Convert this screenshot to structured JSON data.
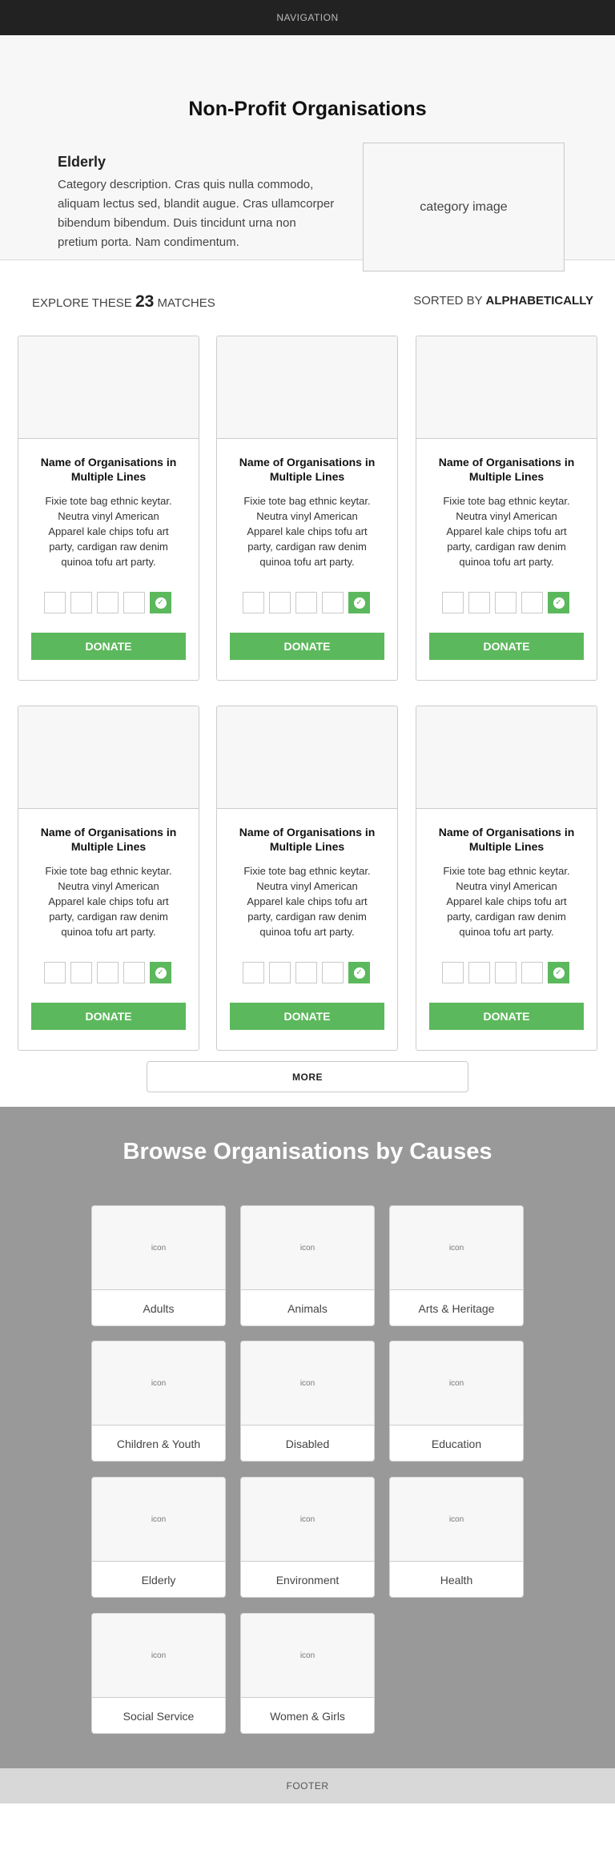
{
  "navigation": {
    "label": "NAVIGATION"
  },
  "hero": {
    "title": "Non-Profit Organisations",
    "category_name": "Elderly",
    "category_description": "Category description. Cras quis nulla commodo, aliquam lectus sed, blandit augue. Cras ullamcorper bibendum bibendum. Duis tincidunt urna non pretium porta. Nam condimentum.",
    "category_image_label": "category image"
  },
  "results": {
    "explore_prefix": "EXPLORE THESE",
    "count": "23",
    "explore_suffix": "MATCHES",
    "sorted_prefix": "SORTED BY",
    "sorted_value": "ALPHABETICALLY"
  },
  "cards": [
    {
      "name": "Name of Organisations in Multiple Lines",
      "description": "Fixie tote bag ethnic keytar. Neutra vinyl American Apparel kale chips tofu art party, cardigan raw denim quinoa tofu art party.",
      "donate_label": "DONATE"
    },
    {
      "name": "Name of Organisations in Multiple Lines",
      "description": "Fixie tote bag ethnic keytar. Neutra vinyl American Apparel kale chips tofu art party, cardigan raw denim quinoa tofu art party.",
      "donate_label": "DONATE"
    },
    {
      "name": "Name of Organisations in Multiple Lines",
      "description": "Fixie tote bag ethnic keytar. Neutra vinyl American Apparel kale chips tofu art party, cardigan raw denim quinoa tofu art party.",
      "donate_label": "DONATE"
    },
    {
      "name": "Name of Organisations in Multiple Lines",
      "description": "Fixie tote bag ethnic keytar. Neutra vinyl American Apparel kale chips tofu art party, cardigan raw denim quinoa tofu art party.",
      "donate_label": "DONATE"
    },
    {
      "name": "Name of Organisations in Multiple Lines",
      "description": "Fixie tote bag ethnic keytar. Neutra vinyl American Apparel kale chips tofu art party, cardigan raw denim quinoa tofu art party.",
      "donate_label": "DONATE"
    },
    {
      "name": "Name of Organisations in Multiple Lines",
      "description": "Fixie tote bag ethnic keytar. Neutra vinyl American Apparel kale chips tofu art party, cardigan raw denim quinoa tofu art party.",
      "donate_label": "DONATE"
    }
  ],
  "more_label": "MORE",
  "causes": {
    "title": "Browse Organisations by Causes",
    "icon_label": "icon",
    "items": [
      "Adults",
      "Animals",
      "Arts & Heritage",
      "Children & Youth",
      "Disabled",
      "Education",
      "Elderly",
      "Environment",
      "Health",
      "Social Service",
      "Women & Girls"
    ]
  },
  "footer": {
    "label": "FOOTER"
  },
  "colors": {
    "accent": "#5cb85c",
    "nav_bg": "#222222",
    "causes_bg": "#999999",
    "footer_bg": "#d8d8d8"
  }
}
